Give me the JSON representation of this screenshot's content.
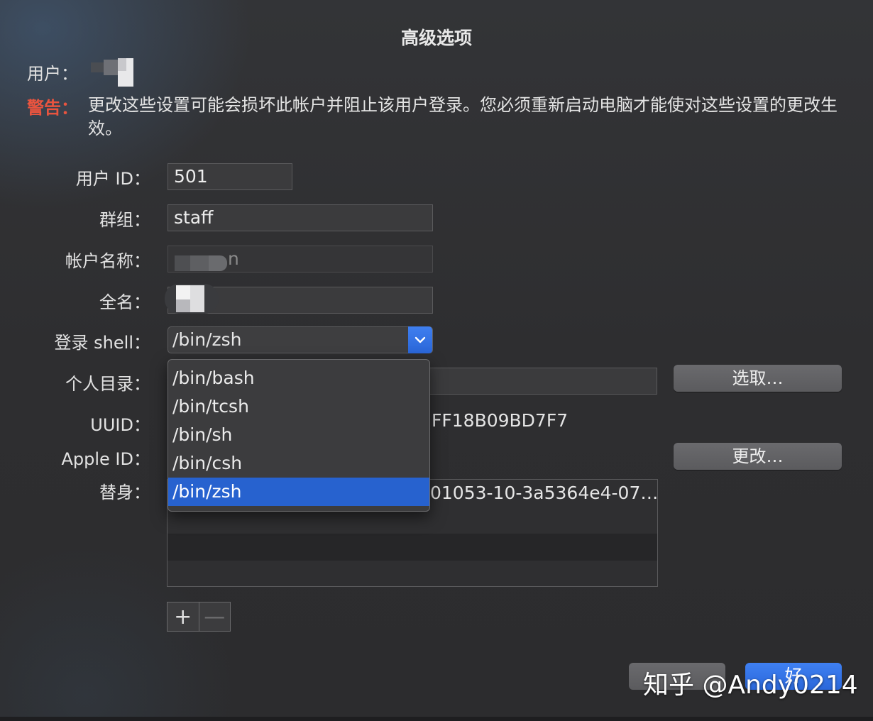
{
  "dialog": {
    "title": "高级选项",
    "user_label": "用户：",
    "warning_label": "警告：",
    "warning_text": "更改这些设置可能会损坏此帐户并阻止该用户登录。您必须重新启动电脑才能使对这些设置的更改生效。"
  },
  "form": {
    "user_id_label": "用户 ID：",
    "user_id_value": "501",
    "group_label": "群组：",
    "group_value": "staff",
    "account_name_label": "帐户名称：",
    "account_name_value": "n",
    "full_name_label": "全名：",
    "login_shell_label": "登录 shell：",
    "login_shell_value": "/bin/zsh",
    "home_dir_label": "个人目录：",
    "choose_button": "选取…",
    "uuid_label": "UUID：",
    "uuid_value": "FF18B09BD7F7",
    "apple_id_label": "Apple ID：",
    "change_button": "更改…",
    "alias_label": "替身：",
    "alias_value": "01053-10-3a5364e4-07…",
    "add_symbol": "+",
    "remove_symbol": "—"
  },
  "shell_menu": {
    "options": [
      "/bin/bash",
      "/bin/tcsh",
      "/bin/sh",
      "/bin/csh",
      "/bin/zsh"
    ],
    "selected": "/bin/zsh"
  },
  "footer": {
    "ok_button": "好",
    "watermark": "知乎 @Andy0214"
  },
  "colors": {
    "accent": "#2762cf",
    "warning": "#e9543f",
    "background": "#2c2c2e"
  }
}
